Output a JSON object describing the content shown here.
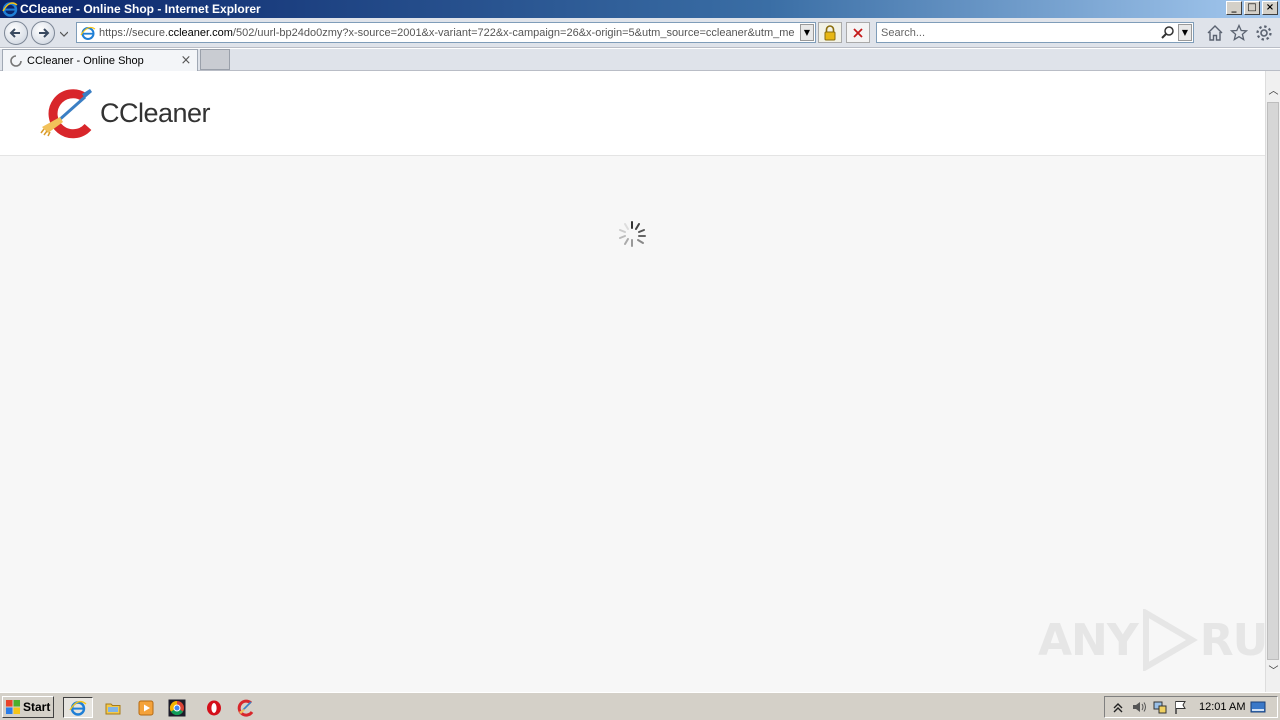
{
  "window": {
    "title": "CCleaner - Online Shop - Internet Explorer",
    "controls": {
      "minimize": "_",
      "maximize": "□",
      "close": "×"
    }
  },
  "address_bar": {
    "url_prefix": "https://secure.",
    "url_domain": "ccleaner.com",
    "url_rest": "/502/uurl-bp24do0zmy?x-source=2001&x-variant=722&x-campaign=26&x-origin=5&utm_source=ccleaner&utm_me",
    "page_icon": "ie-page-icon"
  },
  "search_box": {
    "placeholder": "Search..."
  },
  "tabs": [
    {
      "label": "CCleaner - Online Shop",
      "close": "×"
    }
  ],
  "page": {
    "brand": "CCleaner",
    "loading_icon": "loading-spinner-icon"
  },
  "watermark": {
    "left": "ANY",
    "right": "RUN"
  },
  "taskbar": {
    "start_label": "Start",
    "apps": [
      "internet-explorer",
      "file-explorer",
      "media-player",
      "chrome",
      "opera",
      "ccleaner"
    ],
    "clock": "12:01 AM"
  }
}
